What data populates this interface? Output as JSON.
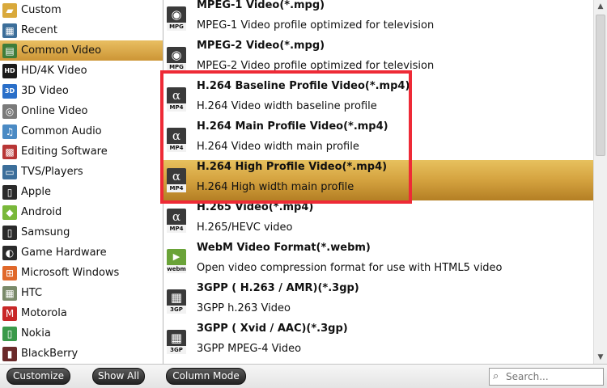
{
  "categories": [
    {
      "label": "Custom",
      "icon": "folder-icon",
      "glyph": "▰",
      "color": "#d9a93b",
      "selected": false
    },
    {
      "label": "Recent",
      "icon": "recent-grid-icon",
      "glyph": "▦",
      "color": "#3c6e9a",
      "selected": false
    },
    {
      "label": "Common Video",
      "icon": "film-strip-icon",
      "glyph": "▤",
      "color": "#3f7d3a",
      "selected": true
    },
    {
      "label": "HD/4K Video",
      "icon": "hd-badge-icon",
      "glyph": "HD",
      "color": "#1b1b1b",
      "selected": false
    },
    {
      "label": "3D Video",
      "icon": "3d-badge-icon",
      "glyph": "3D",
      "color": "#2a6fc9",
      "selected": false
    },
    {
      "label": "Online Video",
      "icon": "globe-icon",
      "glyph": "◎",
      "color": "#7a7a7a",
      "selected": false
    },
    {
      "label": "Common Audio",
      "icon": "music-note-icon",
      "glyph": "♫",
      "color": "#4a8ac4",
      "selected": false
    },
    {
      "label": "Editing Software",
      "icon": "clapperboard-icon",
      "glyph": "▩",
      "color": "#b83636",
      "selected": false
    },
    {
      "label": "TVS/Players",
      "icon": "tv-icon",
      "glyph": "▭",
      "color": "#3c6e9a",
      "selected": false
    },
    {
      "label": "Apple",
      "icon": "phone-icon",
      "glyph": "▯",
      "color": "#2a2a2a",
      "selected": false
    },
    {
      "label": "Android",
      "icon": "android-icon",
      "glyph": "◆",
      "color": "#79b83a",
      "selected": false
    },
    {
      "label": "Samsung",
      "icon": "phone-icon",
      "glyph": "▯",
      "color": "#2a2a2a",
      "selected": false
    },
    {
      "label": "Game Hardware",
      "icon": "gamepad-icon",
      "glyph": "◐",
      "color": "#2a2a2a",
      "selected": false
    },
    {
      "label": "Microsoft Windows",
      "icon": "windows-logo-icon",
      "glyph": "⊞",
      "color": "#e0682a",
      "selected": false
    },
    {
      "label": "HTC",
      "icon": "htc-grid-icon",
      "glyph": "▦",
      "color": "#7a8a6a",
      "selected": false
    },
    {
      "label": "Motorola",
      "icon": "motorola-logo-icon",
      "glyph": "M",
      "color": "#c82828",
      "selected": false
    },
    {
      "label": "Nokia",
      "icon": "phone-icon",
      "glyph": "▯",
      "color": "#3a9a4a",
      "selected": false
    },
    {
      "label": "BlackBerry",
      "icon": "blackberry-icon",
      "glyph": "▮",
      "color": "#6a2a2a",
      "selected": false
    }
  ],
  "formats": [
    {
      "title": "MPEG-1 Video(*.mpg)",
      "desc": "MPEG-1 Video profile optimized for television",
      "icon": "film-reel-icon",
      "glyph": "◉",
      "tag": "MPG",
      "selected": false
    },
    {
      "title": "MPEG-2 Video(*.mpg)",
      "desc": "MPEG-2 Video profile optimized for television",
      "icon": "film-reel-icon",
      "glyph": "◉",
      "tag": "MPG",
      "selected": false
    },
    {
      "title": "H.264 Baseline Profile Video(*.mp4)",
      "desc": "H.264 Video width baseline profile",
      "icon": "mp4-alpha-icon",
      "glyph": "α",
      "tag": "MP4",
      "selected": false
    },
    {
      "title": "H.264 Main Profile Video(*.mp4)",
      "desc": "H.264 Video width main profile",
      "icon": "mp4-alpha-icon",
      "glyph": "α",
      "tag": "MP4",
      "selected": false
    },
    {
      "title": "H.264 High Profile Video(*.mp4)",
      "desc": "H.264 High width main profile",
      "icon": "mp4-alpha-icon",
      "glyph": "α",
      "tag": "MP4",
      "selected": true
    },
    {
      "title": "H.265 Video(*.mp4)",
      "desc": "H.265/HEVC video",
      "icon": "mp4-alpha-icon",
      "glyph": "α",
      "tag": "MP4",
      "selected": false
    },
    {
      "title": "WebM Video Format(*.webm)",
      "desc": "Open video compression format for use with HTML5 video",
      "icon": "webm-play-icon",
      "glyph": "▶",
      "tag": "webm",
      "selected": false
    },
    {
      "title": "3GPP ( H.263 / AMR)(*.3gp)",
      "desc": "3GPP h.263 Video",
      "icon": "3gp-film-icon",
      "glyph": "▦",
      "tag": "3GP",
      "selected": false
    },
    {
      "title": "3GPP ( Xvid / AAC)(*.3gp)",
      "desc": "3GPP MPEG-4 Video",
      "icon": "3gp-film-icon",
      "glyph": "▦",
      "tag": "3GP",
      "selected": false
    }
  ],
  "toolbar": {
    "customize_label": "Customize",
    "show_all_label": "Show All",
    "column_mode_label": "Column Mode",
    "search_placeholder": "Search..."
  },
  "scrollbar": {
    "up_glyph": "▲",
    "down_glyph": "▼"
  },
  "colors": {
    "selected_gold": "#d4a23f",
    "highlight_red": "#ee2a36"
  }
}
